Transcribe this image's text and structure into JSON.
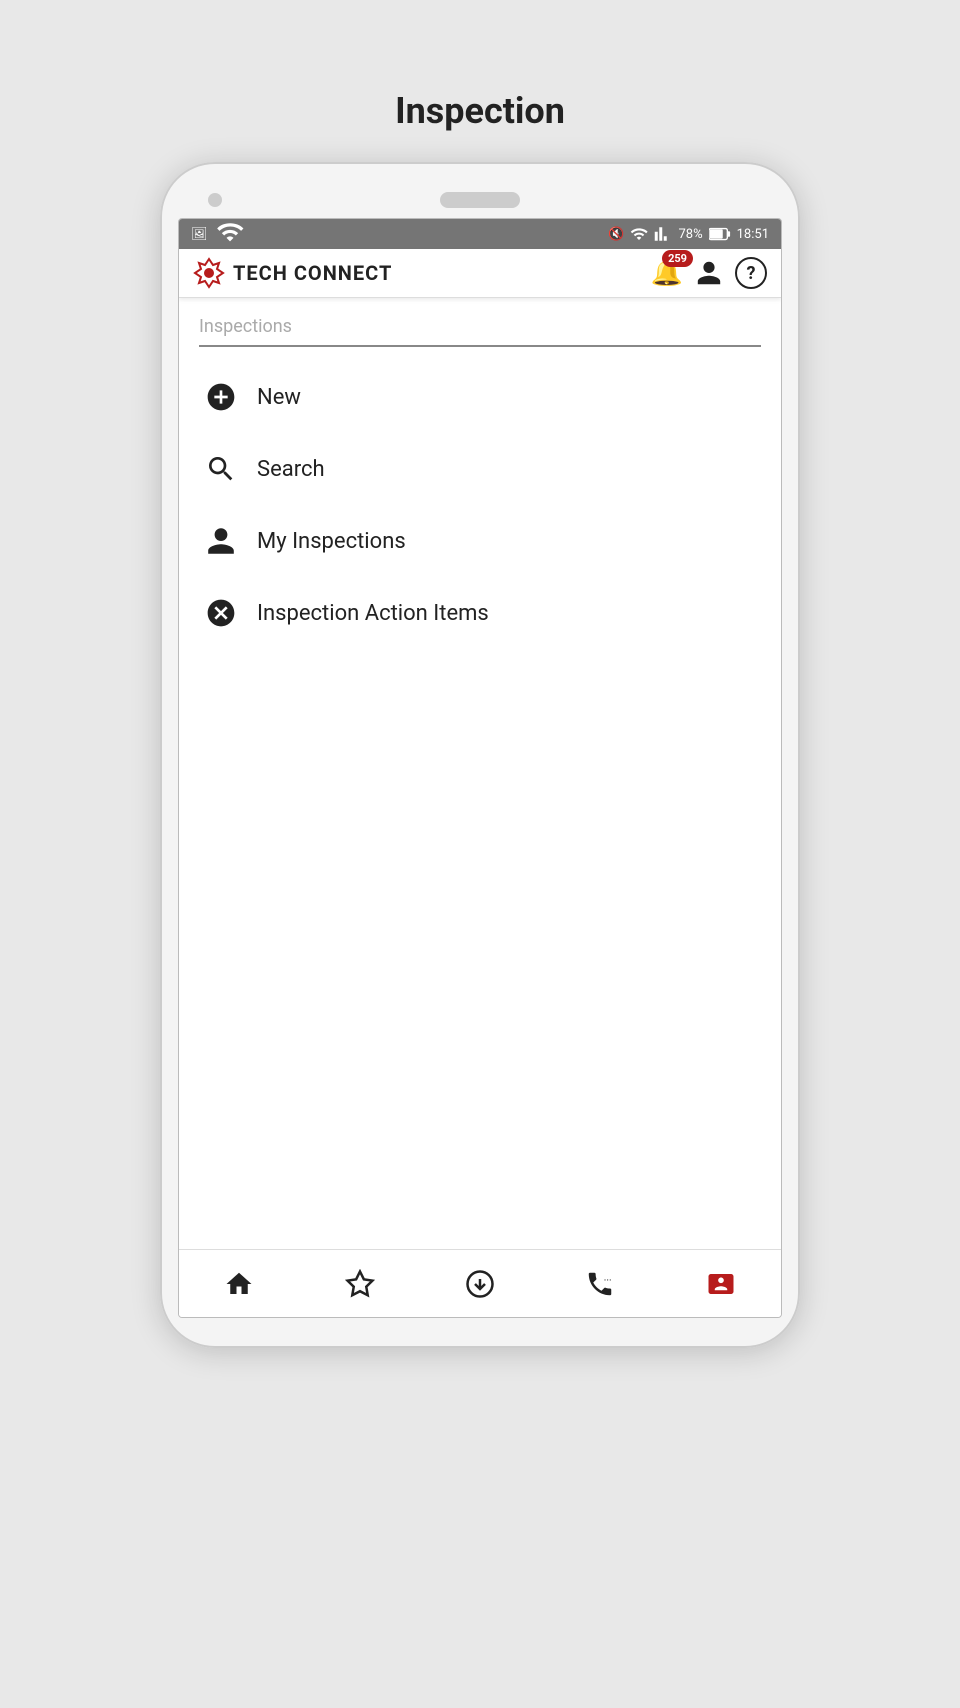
{
  "page": {
    "title": "Inspection"
  },
  "status_bar": {
    "battery": "78%",
    "time": "18:51"
  },
  "header": {
    "logo_text": "TECH CONNECT",
    "notification_count": "259",
    "help_label": "?"
  },
  "content": {
    "section_label": "Inspections",
    "menu_items": [
      {
        "id": "new",
        "label": "New",
        "icon": "plus-circle"
      },
      {
        "id": "search",
        "label": "Search",
        "icon": "search"
      },
      {
        "id": "my-inspections",
        "label": "My Inspections",
        "icon": "person"
      },
      {
        "id": "action-items",
        "label": "Inspection Action Items",
        "icon": "x-circle"
      }
    ]
  },
  "bottom_nav": {
    "items": [
      {
        "id": "home",
        "label": "Home",
        "icon": "home"
      },
      {
        "id": "favorites",
        "label": "Favorites",
        "icon": "star"
      },
      {
        "id": "download",
        "label": "Download",
        "icon": "download"
      },
      {
        "id": "phone",
        "label": "Phone",
        "icon": "phone"
      },
      {
        "id": "contact",
        "label": "Contact",
        "icon": "contact",
        "active": true
      }
    ]
  }
}
